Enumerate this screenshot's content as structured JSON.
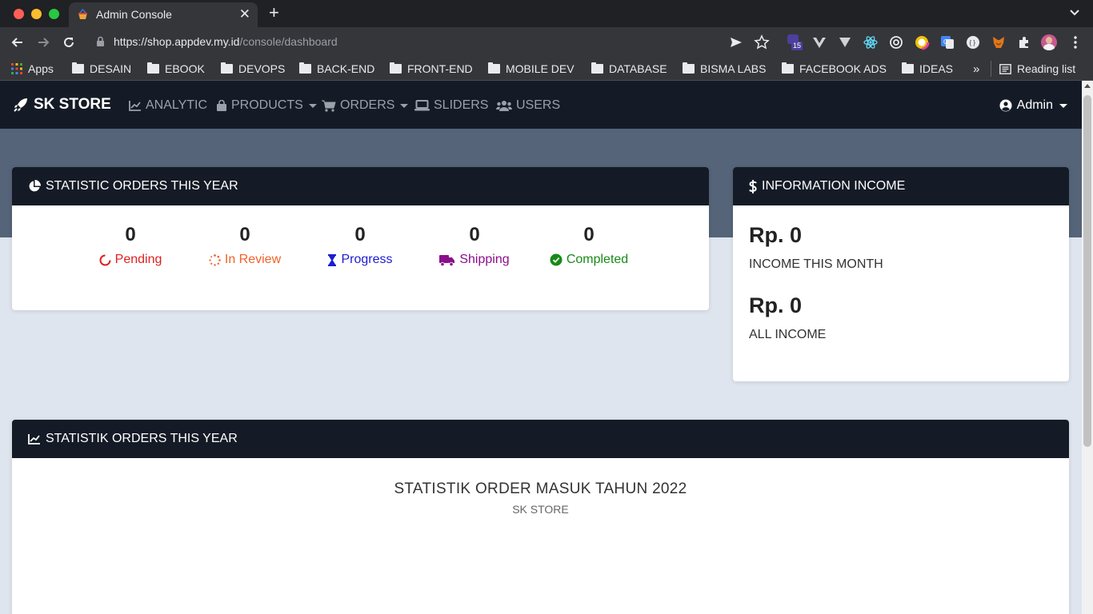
{
  "browser": {
    "tab_title": "Admin Console",
    "url_host": "https://shop.appdev.my.id",
    "url_path": "/console/dashboard",
    "extension_badge": "15",
    "bookmarks": [
      {
        "label": "Apps"
      },
      {
        "label": "DESAIN"
      },
      {
        "label": "EBOOK"
      },
      {
        "label": "DEVOPS"
      },
      {
        "label": "BACK-END"
      },
      {
        "label": "FRONT-END"
      },
      {
        "label": "MOBILE DEV"
      },
      {
        "label": "DATABASE"
      },
      {
        "label": "BISMA LABS"
      },
      {
        "label": "FACEBOOK ADS"
      },
      {
        "label": "IDEAS"
      }
    ],
    "more_bookmarks": "»",
    "reading_list": "Reading list"
  },
  "navbar": {
    "brand": "SK STORE",
    "links": [
      {
        "label": "ANALYTIC",
        "icon": "chart-line-icon"
      },
      {
        "label": "PRODUCTS",
        "icon": "shopping-bag-icon"
      },
      {
        "label": "ORDERS",
        "icon": "cart-icon"
      },
      {
        "label": "SLIDERS",
        "icon": "laptop-icon"
      },
      {
        "label": "USERS",
        "icon": "users-icon"
      }
    ],
    "user": "Admin"
  },
  "statistic": {
    "title": "STATISTIC ORDERS THIS YEAR",
    "items": [
      {
        "value": "0",
        "label": "Pending",
        "color": "#e02020",
        "icon": "spinner-icon"
      },
      {
        "value": "0",
        "label": "In Review",
        "color": "#f0632a",
        "icon": "dots-spinner-icon"
      },
      {
        "value": "0",
        "label": "Progress",
        "color": "#1c1cd6",
        "icon": "hourglass-icon"
      },
      {
        "value": "0",
        "label": "Shipping",
        "color": "#8b0f8b",
        "icon": "truck-icon"
      },
      {
        "value": "0",
        "label": "Completed",
        "color": "#188a18",
        "icon": "check-circle-icon"
      }
    ]
  },
  "income": {
    "title": "INFORMATION INCOME",
    "month_value": "Rp. 0",
    "month_label": "INCOME THIS MONTH",
    "all_value": "Rp. 0",
    "all_label": "ALL INCOME"
  },
  "chart_section": {
    "header": "STATISTIK ORDERS THIS YEAR",
    "title": "STATISTIK ORDER MASUK TAHUN 2022",
    "subtitle": "SK STORE"
  },
  "colors": {
    "navbar": "#151b26",
    "hero": "#556479",
    "background": "#dfe5ee"
  }
}
